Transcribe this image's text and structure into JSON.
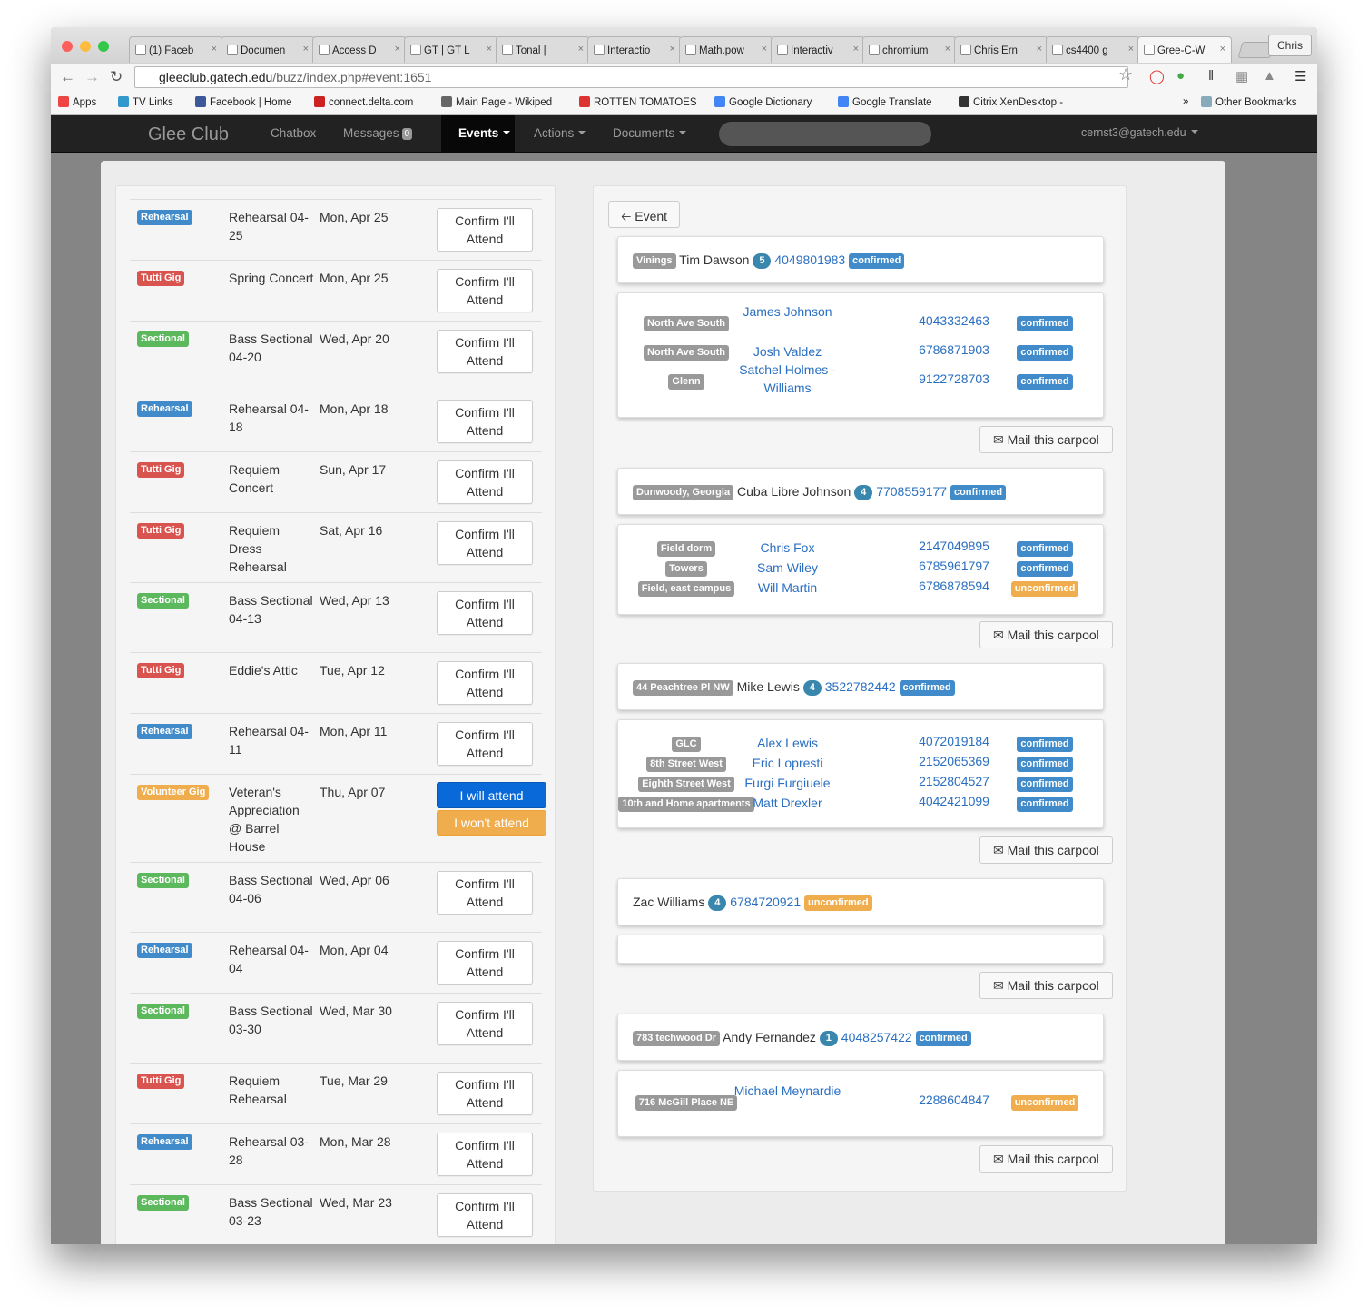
{
  "browser": {
    "tabs": [
      {
        "label": "(1) Faceb",
        "icon": "facebook-icon"
      },
      {
        "label": "Documen",
        "icon": "google-drive-icon"
      },
      {
        "label": "Access D",
        "icon": "access-icon"
      },
      {
        "label": "GT | GT L",
        "icon": "gt-icon"
      },
      {
        "label": "Tonal |",
        "icon": "page-icon"
      },
      {
        "label": "Interactio",
        "icon": "blogger-icon"
      },
      {
        "label": "Math.pow",
        "icon": "page-icon"
      },
      {
        "label": "Interactiv",
        "icon": "page-icon"
      },
      {
        "label": "chromium",
        "icon": "page-icon"
      },
      {
        "label": "Chris Ern",
        "icon": "page-icon"
      },
      {
        "label": "cs4400 g",
        "icon": "google-icon"
      },
      {
        "label": "Gree-C-W",
        "icon": "gleeclub-icon"
      }
    ],
    "profile": "Chris",
    "url_domain": "gleeclub.gatech.edu",
    "url_path": "/buzz/index.php#event:1651",
    "bookmarks": [
      "Apps",
      "TV Links",
      "Facebook | Home",
      "connect.delta.com",
      "Main Page - Wikiped",
      "ROTTEN TOMATOES",
      "Google Dictionary",
      "Google Translate",
      "Citrix XenDesktop -",
      "»",
      "Other Bookmarks"
    ]
  },
  "nav": {
    "brand": "Glee Club",
    "chatbox": "Chatbox",
    "messages": "Messages",
    "messages_count": "0",
    "events": "Events",
    "actions": "Actions",
    "documents": "Documents",
    "user": "cernst3@gatech.edu"
  },
  "events": [
    {
      "type": "Rehearsal",
      "cls": "reh",
      "name": "Rehearsal 04-25",
      "date": "Mon, Apr 25",
      "confirm": "Confirm I'll Attend"
    },
    {
      "type": "Tutti Gig",
      "cls": "tut",
      "name": "Spring Concert",
      "date": "Mon, Apr 25",
      "confirm": "Confirm I'll Attend"
    },
    {
      "type": "Sectional",
      "cls": "sec",
      "name": "Bass Sectional 04-20",
      "date": "Wed, Apr 20",
      "confirm": "Confirm I'll Attend"
    },
    {
      "type": "Rehearsal",
      "cls": "reh",
      "name": "Rehearsal 04-18",
      "date": "Mon, Apr 18",
      "confirm": "Confirm I'll Attend"
    },
    {
      "type": "Tutti Gig",
      "cls": "tut",
      "name": "Requiem Concert",
      "date": "Sun, Apr 17",
      "confirm": "Confirm I'll Attend"
    },
    {
      "type": "Tutti Gig",
      "cls": "tut",
      "name": "Requiem Dress Rehearsal",
      "date": "Sat, Apr 16",
      "confirm": "Confirm I'll Attend"
    },
    {
      "type": "Sectional",
      "cls": "sec",
      "name": "Bass Sectional 04-13",
      "date": "Wed, Apr 13",
      "confirm": "Confirm I'll Attend"
    },
    {
      "type": "Tutti Gig",
      "cls": "tut",
      "name": "Eddie's Attic",
      "date": "Tue, Apr 12",
      "confirm": "Confirm I'll Attend"
    },
    {
      "type": "Rehearsal",
      "cls": "reh",
      "name": "Rehearsal 04-11",
      "date": "Mon, Apr 11",
      "confirm": "Confirm I'll Attend"
    },
    {
      "type": "Volunteer Gig",
      "cls": "vol",
      "name": "Veteran's Appreciation @ Barrel House",
      "date": "Thu, Apr 07",
      "will": "I will attend",
      "wont": "I won't attend"
    },
    {
      "type": "Sectional",
      "cls": "sec",
      "name": "Bass Sectional 04-06",
      "date": "Wed, Apr 06",
      "confirm": "Confirm I'll Attend"
    },
    {
      "type": "Rehearsal",
      "cls": "reh",
      "name": "Rehearsal 04-04",
      "date": "Mon, Apr 04",
      "confirm": "Confirm I'll Attend"
    },
    {
      "type": "Sectional",
      "cls": "sec",
      "name": "Bass Sectional 03-30",
      "date": "Wed, Mar 30",
      "confirm": "Confirm I'll Attend"
    },
    {
      "type": "Tutti Gig",
      "cls": "tut",
      "name": "Requiem Rehearsal",
      "date": "Tue, Mar 29",
      "confirm": "Confirm I'll Attend"
    },
    {
      "type": "Rehearsal",
      "cls": "reh",
      "name": "Rehearsal 03-28",
      "date": "Mon, Mar 28",
      "confirm": "Confirm I'll Attend"
    },
    {
      "type": "Sectional",
      "cls": "sec",
      "name": "Bass Sectional 03-23",
      "date": "Wed, Mar 23",
      "confirm": "Confirm I'll Attend"
    }
  ],
  "back_button": "Event",
  "mail_label": "Mail this carpool",
  "carpools": [
    {
      "driver": {
        "location": "Vinings",
        "name": "Tim Dawson",
        "seats": "5",
        "phone": "4049801983",
        "status": "confirmed"
      },
      "passengers": [
        {
          "location": "North Ave South",
          "name": "James Johnson",
          "phone": "4043332463",
          "status": "confirmed"
        },
        {
          "location": "North Ave South",
          "name": "Josh Valdez",
          "phone": "6786871903",
          "status": "confirmed"
        },
        {
          "location": "Glenn",
          "name": "Satchel Holmes - Williams",
          "phone": "9122728703",
          "status": "confirmed"
        }
      ]
    },
    {
      "driver": {
        "location": "Dunwoody, Georgia",
        "name": "Cuba Libre Johnson",
        "seats": "4",
        "phone": "7708559177",
        "status": "confirmed"
      },
      "passengers": [
        {
          "location": "Field dorm",
          "name": "Chris Fox",
          "phone": "2147049895",
          "status": "confirmed"
        },
        {
          "location": "Towers",
          "name": "Sam Wiley",
          "phone": "6785961797",
          "status": "confirmed"
        },
        {
          "location": "Field, east campus",
          "name": "Will Martin",
          "phone": "6786878594",
          "status": "unconfirmed"
        }
      ]
    },
    {
      "driver": {
        "location": "44 Peachtree Pl NW",
        "name": "Mike Lewis",
        "seats": "4",
        "phone": "3522782442",
        "status": "confirmed"
      },
      "passengers": [
        {
          "location": "GLC",
          "name": "Alex Lewis",
          "phone": "4072019184",
          "status": "confirmed"
        },
        {
          "location": "8th Street West",
          "name": "Eric Lopresti",
          "phone": "2152065369",
          "status": "confirmed"
        },
        {
          "location": "Eighth Street West",
          "name": "Furgi Furgiuele",
          "phone": "2152804527",
          "status": "confirmed"
        },
        {
          "location": "10th and Home apartments",
          "name": "Matt Drexler",
          "phone": "4042421099",
          "status": "confirmed"
        }
      ]
    },
    {
      "driver": {
        "location": "",
        "name": "Zac Williams",
        "seats": "4",
        "phone": "6784720921",
        "status": "unconfirmed"
      },
      "passengers": []
    },
    {
      "driver": {
        "location": "783 techwood Dr",
        "name": "Andy Fernandez",
        "seats": "1",
        "phone": "4048257422",
        "status": "confirmed"
      },
      "passengers": [
        {
          "location": "716 McGill Place NE",
          "name": "Michael Meynardie",
          "phone": "2288604847",
          "status": "unconfirmed"
        }
      ]
    }
  ]
}
